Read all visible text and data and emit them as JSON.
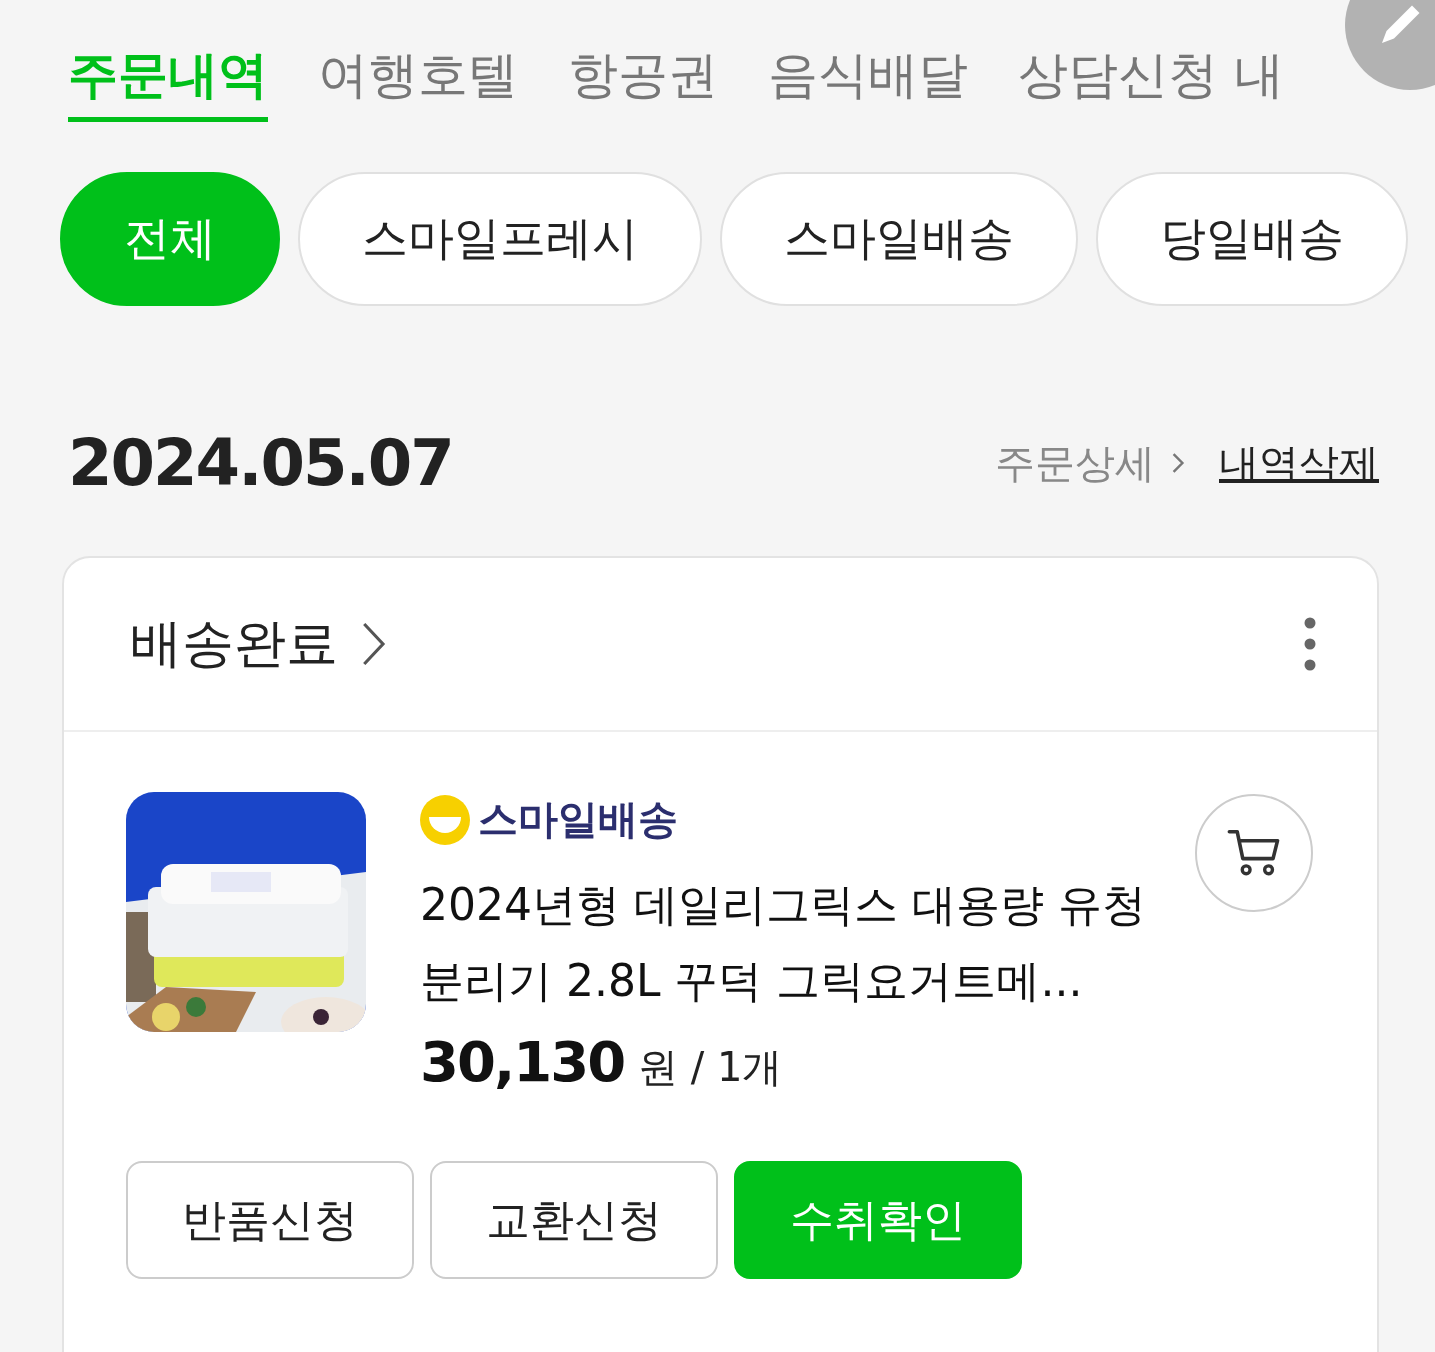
{
  "tabs": [
    {
      "label": "주문내역",
      "selected": true
    },
    {
      "label": "여행호텔",
      "selected": false
    },
    {
      "label": "항공권",
      "selected": false
    },
    {
      "label": "음식배달",
      "selected": false
    },
    {
      "label": "상담신청 내",
      "selected": false
    }
  ],
  "filters": [
    {
      "label": "전체",
      "selected": true
    },
    {
      "label": "스마일프레시",
      "selected": false
    },
    {
      "label": "스마일배송",
      "selected": false
    },
    {
      "label": "당일배송",
      "selected": false
    }
  ],
  "order": {
    "date": "2024.05.07",
    "detail_link": "주문상세",
    "delete_link": "내역삭제",
    "status": "배송완료",
    "product": {
      "delivery_badge": "**스마일**배송",
      "title": "2024년형 데일리그릭스 대용량 유청분리기 2.8L 꾸덕 그릭요거트메...",
      "price": "30,130",
      "unit": "원 / 1개"
    },
    "actions": [
      {
        "label": "반품신청",
        "primary": false
      },
      {
        "label": "교환신청",
        "primary": false
      },
      {
        "label": "수취확인",
        "primary": true
      }
    ]
  }
}
